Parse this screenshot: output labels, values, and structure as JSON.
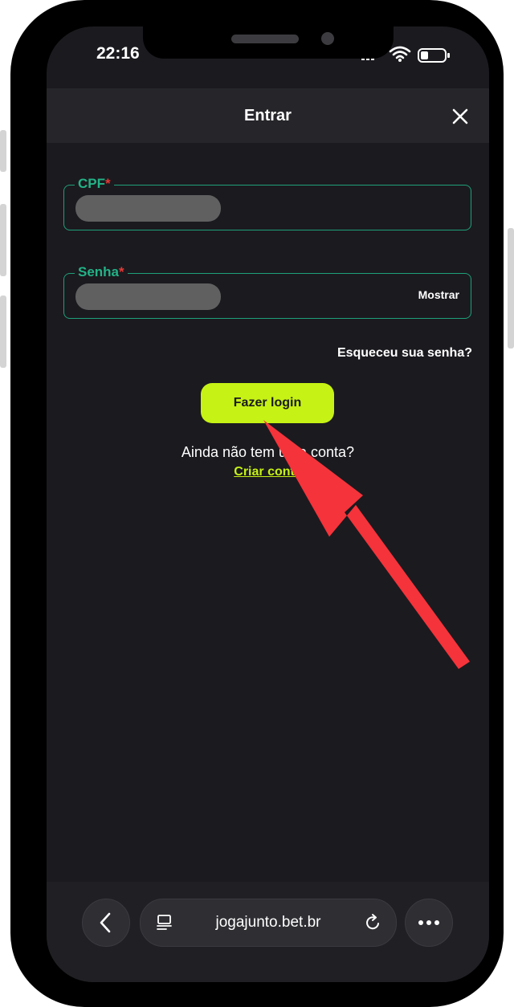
{
  "status_bar": {
    "time": "22:16",
    "icons": [
      "cellular-icon",
      "wifi-icon",
      "battery-icon"
    ]
  },
  "header": {
    "title": "Entrar",
    "close_icon": "close-icon"
  },
  "form": {
    "cpf": {
      "label": "CPF",
      "required_mark": "*",
      "value": ""
    },
    "password": {
      "label": "Senha",
      "required_mark": "*",
      "value": "",
      "show_label": "Mostrar"
    },
    "forgot_label": "Esqueceu sua senha?",
    "submit_label": "Fazer login",
    "no_account_text": "Ainda não tem uma conta?",
    "create_label": "Criar conta"
  },
  "browser": {
    "url": "jogajunto.bet.br",
    "icons": [
      "back-icon",
      "page-menu-icon",
      "reload-icon",
      "more-icon"
    ]
  },
  "colors": {
    "background": "#1b1a1f",
    "accent": "#c6f215",
    "field_border": "#1ea07a",
    "label": "#23b387",
    "required": "#e53935",
    "annotation_arrow": "#f5333a"
  }
}
